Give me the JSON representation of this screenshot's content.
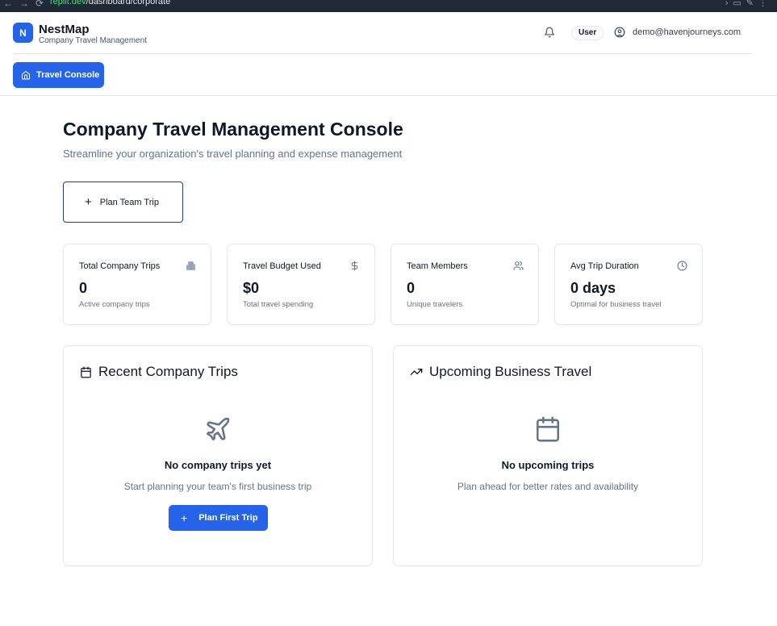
{
  "browser": {
    "url_host": "replit.dev",
    "url_path": "/dashboard/corporate"
  },
  "header": {
    "logo_letter": "N",
    "brand": "NestMap",
    "tagline": "Company Travel Management",
    "role_badge": "User",
    "user_email": "demo@havenjourneys.com",
    "nav_button": "Travel Console"
  },
  "main": {
    "title": "Company Travel Management Console",
    "subtitle": "Streamline your organization's travel planning and expense management",
    "plan_button": "Plan Team Trip",
    "stats": [
      {
        "label": "Total Company Trips",
        "value": "0",
        "desc": "Active company trips",
        "icon": "building-icon"
      },
      {
        "label": "Travel Budget Used",
        "value": "$0",
        "desc": "Total travel spending",
        "icon": "dollar-icon"
      },
      {
        "label": "Team Members",
        "value": "0",
        "desc": "Unique travelers",
        "icon": "users-icon"
      },
      {
        "label": "Avg Trip Duration",
        "value": "0 days",
        "desc": "Optimal for business travel",
        "icon": "clock-icon"
      }
    ],
    "recent": {
      "title": "Recent Company Trips",
      "empty_title": "No company trips yet",
      "empty_hint": "Start planning your team's first business trip",
      "button": "Plan First Trip"
    },
    "upcoming": {
      "title": "Upcoming Business Travel",
      "empty_title": "No upcoming trips",
      "empty_hint": "Plan ahead for better rates and availability"
    }
  },
  "colors": {
    "primary": "#2563eb",
    "text": "#0f172a",
    "muted": "#64748b",
    "border": "#e5e7eb"
  }
}
